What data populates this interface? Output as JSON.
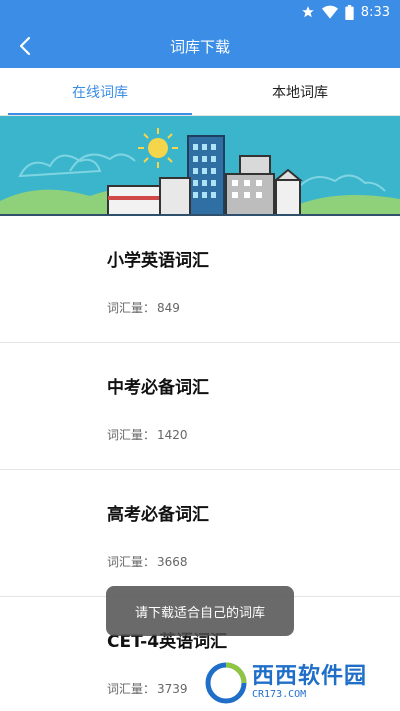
{
  "status_bar": {
    "time": "8:33"
  },
  "header": {
    "title": "词库下载"
  },
  "tabs": [
    {
      "label": "在线词库",
      "active": true
    },
    {
      "label": "本地词库",
      "active": false
    }
  ],
  "list": [
    {
      "title": "小学英语词汇",
      "count_label": "词汇量：",
      "count": "849"
    },
    {
      "title": "中考必备词汇",
      "count_label": "词汇量：",
      "count": "1420"
    },
    {
      "title": "高考必备词汇",
      "count_label": "词汇量：",
      "count": "3668"
    },
    {
      "title": "CET-4英语词汇",
      "count_label": "词汇量：",
      "count": "3739"
    }
  ],
  "toast": {
    "message": "请下载适合自己的词库"
  },
  "watermark": {
    "name": "西西软件园",
    "site": "CR173.COM"
  },
  "colors": {
    "primary": "#3b8de6",
    "banner": "#3ab5cc"
  }
}
